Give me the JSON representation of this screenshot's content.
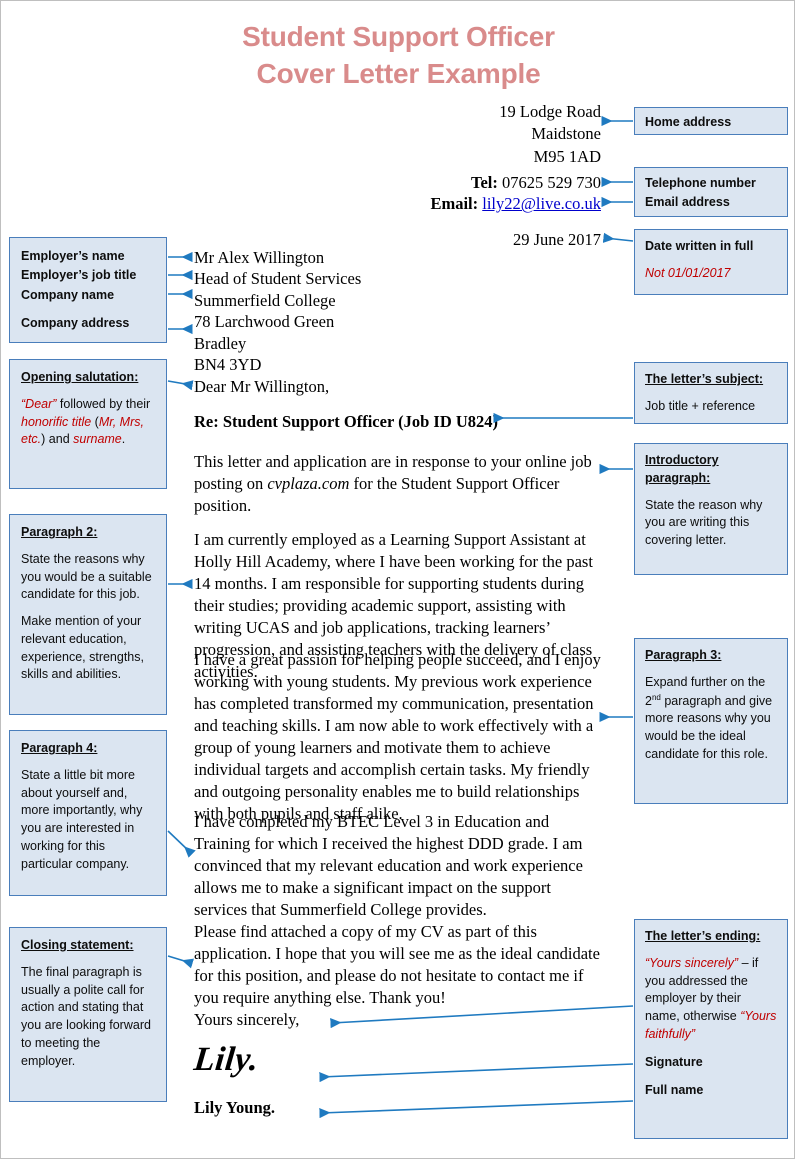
{
  "title": {
    "line1": "Student Support Officer",
    "line2": "Cover Letter Example",
    "color": "#d98b8b"
  },
  "colors": {
    "box_fill": "#dbe5f1",
    "box_border": "#4a7ebb",
    "arrow": "#1f7ac0",
    "accent_red": "#c00000",
    "link": "#0000cc"
  },
  "letter": {
    "sender_address": [
      "19 Lodge Road",
      "Maidstone",
      "M95 1AD"
    ],
    "tel_label": "Tel:",
    "tel_value": "07625 529 730",
    "email_label": "Email:",
    "email_value": "lily22@live.co.uk",
    "date": "29 June 2017",
    "recipient": [
      "Mr Alex Willington",
      "Head of Student Services",
      "Summerfield College",
      "78 Larchwood Green",
      "Bradley",
      "BN4 3YD"
    ],
    "salutation": "Dear Mr Willington,",
    "subject": "Re: Student Support Officer (Job ID U824)",
    "p1_a": "This letter and application are in response to your online job posting on ",
    "p1_italic": "cvplaza.com",
    "p1_b": " for the Student Support Officer position.",
    "p2": "I am currently employed as a Learning Support Assistant at Holly Hill Academy, where I have been working for the past 14 months. I am responsible for supporting students during their studies; providing academic support, assisting with writing UCAS and job applications, tracking learners’ progression, and assisting teachers with the delivery of class activities.",
    "p3": "I have a great passion for helping people succeed, and I enjoy working with young students. My previous work experience has completed transformed my communication, presentation and teaching skills. I am now able to work effectively with a group of young learners and motivate them to achieve individual targets and accomplish certain tasks. My friendly and outgoing personality enables me to build relationships with both pupils and staff alike.",
    "p4": "I have completed my BTEC Level 3 in Education and Training for which I received the highest DDD grade. I am convinced that my relevant education and work experience allows me to make a significant impact on the support services that Summerfield College provides.",
    "p5": "Please find attached a copy of my CV as part of this application. I hope that you will see me as the ideal candidate for this position, and please do not hesitate to contact me if you require anything else. Thank you!",
    "signoff": "Yours sincerely,",
    "signature": "Lily.",
    "full_name": "Lily Young."
  },
  "callouts": {
    "home_address": {
      "label": "Home address"
    },
    "telephone_email": {
      "line1": "Telephone number",
      "line2": "Email address"
    },
    "date_box": {
      "heading": "Date written in full",
      "note": "Not 01/01/2017"
    },
    "employer": {
      "line1": "Employer’s name",
      "line2": "Employer’s job title",
      "line3": "Company name",
      "line4": "Company address"
    },
    "salutation_box": {
      "heading": "Opening salutation:",
      "t1": "“Dear”",
      "t2": " followed by their ",
      "t3": "honorific title",
      "t4": " (",
      "t5": "Mr, Mrs, etc.",
      "t6": ") and ",
      "t7": "surname",
      "t8": "."
    },
    "subject_box": {
      "heading": "The letter’s subject:",
      "body": "Job title + reference"
    },
    "intro_box": {
      "heading1": "Introductory",
      "heading2": "paragraph:",
      "body": "State the reason why you are writing this covering letter."
    },
    "para2_box": {
      "heading": "Paragraph 2:",
      "body1": "State the reasons why you would be a suitable candidate for this job.",
      "body2": "Make mention of your relevant education, experience, strengths, skills and abilities."
    },
    "para3_box": {
      "heading": "Paragraph 3:",
      "b1": "Expand further on the 2",
      "sup": "nd",
      "b2": " paragraph and give more reasons why you would be the ideal candidate for this role."
    },
    "para4_box": {
      "heading": "Paragraph 4:",
      "body": "State a little bit more about yourself and, more importantly, why you are interested in working for this particular company."
    },
    "closing_box": {
      "heading": "Closing statement:",
      "body": "The final paragraph is usually a polite call for action and stating that you are looking forward to meeting the employer."
    },
    "ending_box": {
      "heading": "The letter’s ending:",
      "t1": "“Yours sincerely”",
      "t2": " – if you addressed the employer by their name, otherwise ",
      "t3": "“Yours faithfully”",
      "signature_label": "Signature",
      "fullname_label": "Full name"
    }
  }
}
